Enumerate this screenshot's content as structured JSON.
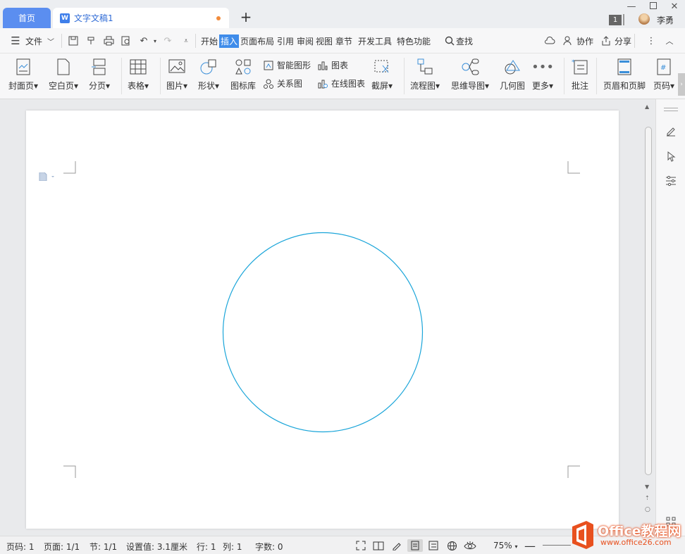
{
  "tabs": {
    "home": "首页",
    "document": "文字文稿1",
    "document_icon": "W"
  },
  "window": {
    "badge": "1",
    "user": "李勇"
  },
  "menu": {
    "file": "文件",
    "items": [
      "开始",
      "插入",
      "页面布局",
      "引用",
      "审阅",
      "视图",
      "章节",
      "开发工具",
      "特色功能"
    ],
    "active": "插入",
    "search": "查找",
    "collaborate": "协作",
    "share": "分享"
  },
  "ribbon": {
    "cover": "封面页",
    "blank": "空白页",
    "page_break": "分页",
    "table": "表格",
    "picture": "图片",
    "shape": "形状",
    "icon_lib": "图标库",
    "smart_art": "智能图形",
    "chart": "图表",
    "relation": "关系图",
    "online_chart": "在线图表",
    "screenshot": "截屏",
    "flowchart": "流程图",
    "mindmap": "思维导图",
    "geometry": "几何图",
    "more": "更多",
    "comment": "批注",
    "header_footer": "页眉和页脚",
    "page_number": "页码"
  },
  "document": {
    "shape": "circle",
    "shape_color": "#1aa5d9"
  },
  "status": {
    "page_code": "页码: 1",
    "pages": "页面: 1/1",
    "section": "节: 1/1",
    "setting": "设置值: 3.1厘米",
    "row": "行: 1",
    "col": "列: 1",
    "words": "字数: 0",
    "zoom": "75%"
  },
  "watermark": {
    "brand": "Office教程网",
    "url": "www.office26.com"
  },
  "colors": {
    "accent": "#3f8cea",
    "home_tab": "#5b8ef0",
    "circle": "#1aa5d9",
    "watermark": "#e8501e"
  }
}
